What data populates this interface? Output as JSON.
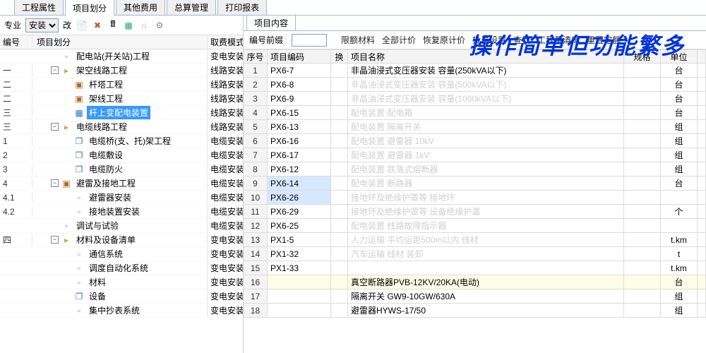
{
  "caption": "操作简单但功能繁多",
  "topTabs": {
    "items": [
      "工程属性",
      "项目划分",
      "其他费用",
      "总算管理",
      "打印报表"
    ],
    "active": 1
  },
  "left": {
    "labels": {
      "专业": "专业",
      "改": "改"
    },
    "combo": {
      "selected": "安装"
    },
    "treeHead": {
      "num": "编号",
      "name": "项目划分",
      "mode": "取费模式"
    },
    "rows": [
      {
        "num": "",
        "indent": 0,
        "exp": "",
        "icon": "file",
        "label": "配电站(开关站)工程",
        "mode": "变电安装"
      },
      {
        "num": "一",
        "indent": 0,
        "exp": "-",
        "icon": "folder",
        "label": "架空线路工程",
        "mode": "线路安装"
      },
      {
        "num": "二",
        "indent": 1,
        "exp": "",
        "icon": "book",
        "label": "杆塔工程",
        "mode": "线路安装"
      },
      {
        "num": "二",
        "indent": 1,
        "exp": "",
        "icon": "book",
        "label": "架线工程",
        "mode": "线路安装"
      },
      {
        "num": "三",
        "indent": 1,
        "exp": "",
        "icon": "sel",
        "label": "杆上变配电装置",
        "mode": "线路安装",
        "selected": true
      },
      {
        "num": "三",
        "indent": 0,
        "exp": "-",
        "icon": "folder",
        "label": "电缆线路工程",
        "mode": "线路安装"
      },
      {
        "num": "1",
        "indent": 1,
        "exp": "",
        "icon": "copy",
        "label": "电缆桥(支、托)架工程",
        "mode": "电缆安装"
      },
      {
        "num": "2",
        "indent": 1,
        "exp": "",
        "icon": "copy",
        "label": "电缆敷设",
        "mode": "电缆安装"
      },
      {
        "num": "3",
        "indent": 1,
        "exp": "",
        "icon": "copy",
        "label": "电缆防火",
        "mode": "电缆安装"
      },
      {
        "num": "4",
        "indent": 0,
        "exp": "-",
        "icon": "book",
        "label": "避雷及接地工程",
        "mode": "电缆安装"
      },
      {
        "num": "4.1",
        "indent": 1,
        "exp": "",
        "icon": "file",
        "label": "避雷器安装",
        "mode": "电缆安装"
      },
      {
        "num": "4.2",
        "indent": 1,
        "exp": "",
        "icon": "file",
        "label": "接地装置安装",
        "mode": "电缆安装"
      },
      {
        "num": "",
        "indent": 0,
        "exp": "",
        "icon": "file",
        "label": "调试与试验",
        "mode": "电缆安装"
      },
      {
        "num": "四",
        "indent": 0,
        "exp": "-",
        "icon": "folder",
        "label": "材料及设备清单",
        "mode": "变电安装"
      },
      {
        "num": "",
        "indent": 1,
        "exp": "",
        "icon": "file",
        "label": "通信系统",
        "mode": "变电安装"
      },
      {
        "num": "",
        "indent": 1,
        "exp": "",
        "icon": "file",
        "label": "调度自动化系统",
        "mode": "变电安装"
      },
      {
        "num": "",
        "indent": 1,
        "exp": "",
        "icon": "file",
        "label": "材料",
        "mode": "变电安装"
      },
      {
        "num": "",
        "indent": 1,
        "exp": "",
        "icon": "copy",
        "label": "设备",
        "mode": "变电安装"
      },
      {
        "num": "",
        "indent": 1,
        "exp": "",
        "icon": "file",
        "label": "集中抄表系统",
        "mode": "变电安装"
      }
    ]
  },
  "right": {
    "tab": "项目内容",
    "toolbar": {
      "prefixLabel": "编号前缀",
      "items": [
        "限额材料",
        "全部计价",
        "恢复原计价",
        "批量设置",
        "查找",
        "工程量清零",
        "重置定额"
      ]
    },
    "gridHead": {
      "seq": "序号",
      "code": "项目编码",
      "swap": "换",
      "name": "项目名称",
      "spec": "规格",
      "unit": "单位"
    },
    "rows": [
      {
        "seq": "1",
        "code": "PX6-7",
        "name": "非晶油浸式变压器安装 容量(250kVA以下)",
        "unit": "台",
        "ghost": false
      },
      {
        "seq": "2",
        "code": "PX6-8",
        "name": "非晶油浸式变压器安装 容量(500kVA以下)",
        "unit": "台",
        "ghost": true
      },
      {
        "seq": "3",
        "code": "PX6-9",
        "name": "非晶油浸式变压器安装 容量(1000kVA以下)",
        "unit": "台",
        "ghost": true
      },
      {
        "seq": "4",
        "code": "PX6-15",
        "name": "配电装置 配电箱",
        "unit": "台",
        "ghost": true
      },
      {
        "seq": "5",
        "code": "PX6-13",
        "name": "配电装置 隔离开关",
        "unit": "组",
        "ghost": true
      },
      {
        "seq": "6",
        "code": "PX6-16",
        "name": "配电装置 避雷器 10kV",
        "unit": "组",
        "ghost": true
      },
      {
        "seq": "7",
        "code": "PX6-17",
        "name": "配电装置 避雷器 1kV",
        "unit": "组",
        "ghost": true
      },
      {
        "seq": "8",
        "code": "PX6-12",
        "name": "配电装置 跌落式熔断器",
        "unit": "组",
        "ghost": true
      },
      {
        "seq": "9",
        "code": "PX6-14",
        "name": "配电装置 断路器",
        "unit": "台",
        "ghost": true,
        "hl": "sel"
      },
      {
        "seq": "10",
        "code": "PX6-26",
        "name": "接地环及绝缘护罩等 接地环",
        "unit": "",
        "ghost": true,
        "hl": "sel"
      },
      {
        "seq": "11",
        "code": "PX6-29",
        "name": "接地环及绝缘护罩等 设备绝缘护罩",
        "unit": "个",
        "ghost": true
      },
      {
        "seq": "12",
        "code": "PX6-25",
        "name": "配电装置 线路故障指示器",
        "unit": "",
        "ghost": true
      },
      {
        "seq": "13",
        "code": "PX1-5",
        "name": "人力运输 平均运距500m以内 线材",
        "unit": "t.km",
        "ghost": true
      },
      {
        "seq": "14",
        "code": "PX1-32",
        "name": "汽车运输 线材 装卸",
        "unit": "t",
        "ghost": true
      },
      {
        "seq": "15",
        "code": "PX1-33",
        "name": "",
        "unit": "t.km",
        "ghost": true
      },
      {
        "seq": "16",
        "code": "",
        "name": "真空断路器PVB-12KV/20KA(电动)",
        "unit": "台",
        "ghost": false,
        "hl": "yellow"
      },
      {
        "seq": "17",
        "code": "",
        "name": "隔离开关 GW9-10GW/630A",
        "unit": "组",
        "ghost": false
      },
      {
        "seq": "18",
        "code": "",
        "name": "避雷器HYWS-17/50",
        "unit": "组",
        "ghost": false
      }
    ]
  }
}
